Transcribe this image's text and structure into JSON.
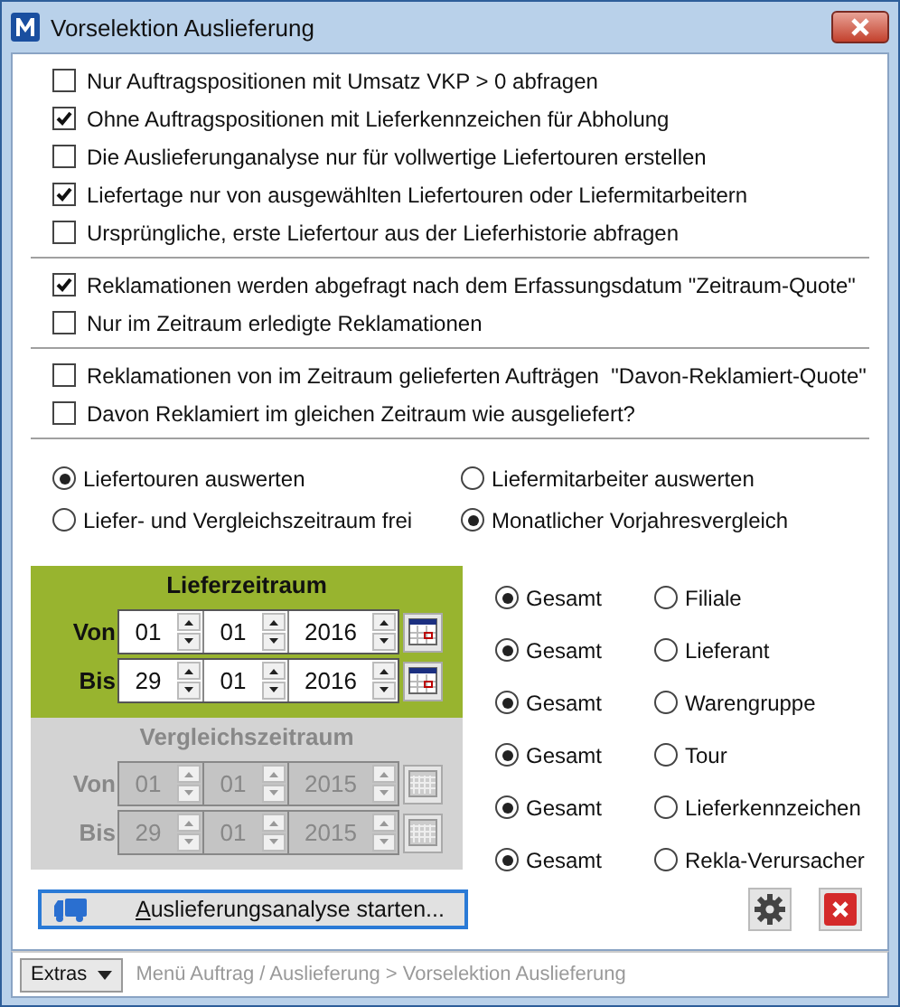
{
  "window": {
    "title": "Vorselektion Auslieferung"
  },
  "checkbox_groups": [
    [
      {
        "label": "Nur Auftragspositionen mit Umsatz VKP > 0 abfragen",
        "checked": false
      },
      {
        "label": "Ohne Auftragspositionen mit Lieferkennzeichen für Abholung",
        "checked": true
      },
      {
        "label": "Die Auslieferunganalyse nur für vollwertige Liefertouren erstellen",
        "checked": false
      },
      {
        "label": "Liefertage nur von ausgewählten Liefertouren oder Liefermitarbeitern",
        "checked": true
      },
      {
        "label": "Ursprüngliche, erste Liefertour aus der Lieferhistorie abfragen",
        "checked": false
      }
    ],
    [
      {
        "label": "Reklamationen werden abgefragt nach dem Erfassungsdatum \"Zeitraum-Quote\"",
        "checked": true
      },
      {
        "label": "Nur im Zeitraum erledigte Reklamationen",
        "checked": false
      }
    ],
    [
      {
        "label": "Reklamationen von im Zeitraum gelieferten Aufträgen  \"Davon-Reklamiert-Quote\"",
        "checked": false
      },
      {
        "label": "Davon Reklamiert im gleichen Zeitraum wie ausgeliefert?",
        "checked": false
      }
    ]
  ],
  "radio_rows": [
    [
      {
        "label": "Liefertouren auswerten",
        "selected": true
      },
      {
        "label": "Liefermitarbeiter auswerten",
        "selected": false
      }
    ],
    [
      {
        "label": "Liefer- und Vergleichszeitraum frei",
        "selected": false
      },
      {
        "label": "Monatlicher Vorjahresvergleich",
        "selected": true
      }
    ]
  ],
  "periods": [
    {
      "title": "Lieferzeitraum",
      "disabled": false,
      "rows": [
        {
          "label": "Von",
          "day": "01",
          "month": "01",
          "year": "2016"
        },
        {
          "label": "Bis",
          "day": "29",
          "month": "01",
          "year": "2016"
        }
      ]
    },
    {
      "title": "Vergleichszeitraum",
      "disabled": true,
      "rows": [
        {
          "label": "Von",
          "day": "01",
          "month": "01",
          "year": "2015"
        },
        {
          "label": "Bis",
          "day": "29",
          "month": "01",
          "year": "2015"
        }
      ]
    }
  ],
  "groupings": [
    [
      {
        "label": "Gesamt",
        "selected": true
      },
      {
        "label": "Filiale",
        "selected": false
      }
    ],
    [
      {
        "label": "Gesamt",
        "selected": true
      },
      {
        "label": "Lieferant",
        "selected": false
      }
    ],
    [
      {
        "label": "Gesamt",
        "selected": true
      },
      {
        "label": "Warengruppe",
        "selected": false
      }
    ],
    [
      {
        "label": "Gesamt",
        "selected": true
      },
      {
        "label": "Tour",
        "selected": false
      }
    ],
    [
      {
        "label": "Gesamt",
        "selected": true
      },
      {
        "label": "Lieferkennzeichen",
        "selected": false
      }
    ],
    [
      {
        "label": "Gesamt",
        "selected": true
      },
      {
        "label": "Rekla-Verursacher",
        "selected": false
      }
    ]
  ],
  "start_button": {
    "label": "Auslieferungsanalyse starten..."
  },
  "status_bar": {
    "extras": "Extras",
    "breadcrumb": "Menü Auftrag / Auslieferung > Vorselektion Auslieferung"
  }
}
